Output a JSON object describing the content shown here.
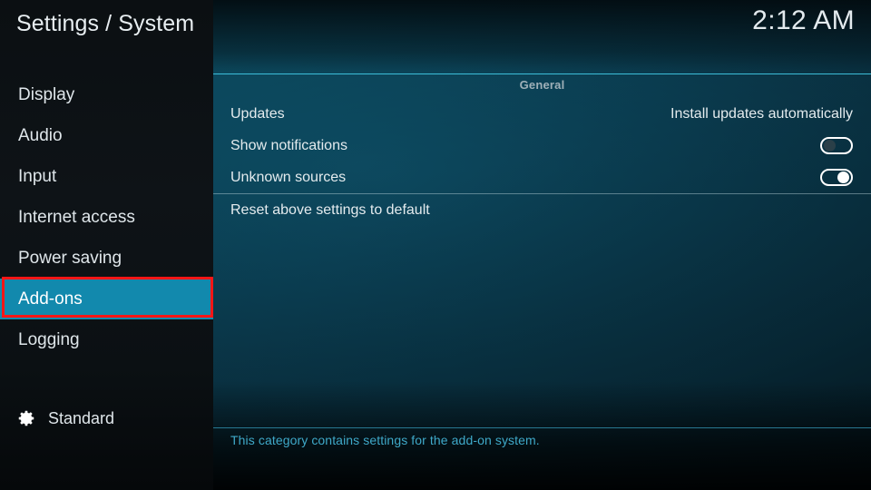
{
  "header": {
    "title": "Settings / System",
    "clock": "2:12 AM"
  },
  "sidebar": {
    "items": [
      {
        "label": "Display",
        "selected": false
      },
      {
        "label": "Audio",
        "selected": false
      },
      {
        "label": "Input",
        "selected": false
      },
      {
        "label": "Internet access",
        "selected": false
      },
      {
        "label": "Power saving",
        "selected": false
      },
      {
        "label": "Add-ons",
        "selected": true
      },
      {
        "label": "Logging",
        "selected": false
      }
    ],
    "level": {
      "icon": "gear-icon",
      "label": "Standard"
    }
  },
  "content": {
    "group_title": "General",
    "settings": [
      {
        "label": "Updates",
        "control": "value",
        "value": "Install updates automatically"
      },
      {
        "label": "Show notifications",
        "control": "toggle",
        "value": "off"
      },
      {
        "label": "Unknown sources",
        "control": "toggle",
        "value": "on"
      }
    ],
    "reset_label": "Reset above settings to default",
    "help_text": "This category contains settings for the add-on system."
  },
  "annotation": {
    "target": "Add-ons",
    "color": "#fe1616"
  },
  "colors": {
    "highlight": "#1289ad",
    "rule": "#3fc5e0",
    "help": "#3fa9c9",
    "sidebar_bg": "#0b0f12"
  }
}
